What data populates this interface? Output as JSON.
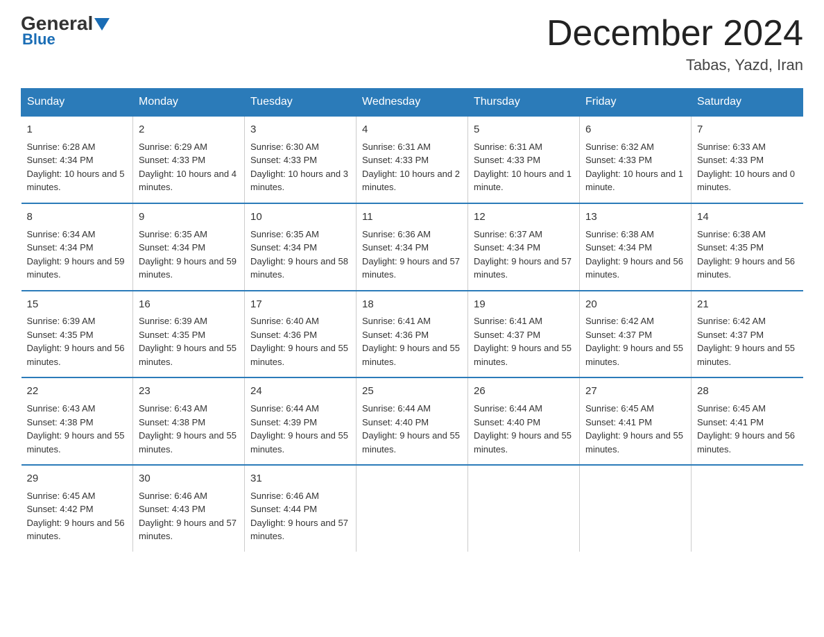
{
  "header": {
    "logo_general": "General",
    "logo_blue": "Blue",
    "month_title": "December 2024",
    "location": "Tabas, Yazd, Iran"
  },
  "days_of_week": [
    "Sunday",
    "Monday",
    "Tuesday",
    "Wednesday",
    "Thursday",
    "Friday",
    "Saturday"
  ],
  "weeks": [
    [
      {
        "day": "1",
        "sunrise": "6:28 AM",
        "sunset": "4:34 PM",
        "daylight": "10 hours and 5 minutes."
      },
      {
        "day": "2",
        "sunrise": "6:29 AM",
        "sunset": "4:33 PM",
        "daylight": "10 hours and 4 minutes."
      },
      {
        "day": "3",
        "sunrise": "6:30 AM",
        "sunset": "4:33 PM",
        "daylight": "10 hours and 3 minutes."
      },
      {
        "day": "4",
        "sunrise": "6:31 AM",
        "sunset": "4:33 PM",
        "daylight": "10 hours and 2 minutes."
      },
      {
        "day": "5",
        "sunrise": "6:31 AM",
        "sunset": "4:33 PM",
        "daylight": "10 hours and 1 minute."
      },
      {
        "day": "6",
        "sunrise": "6:32 AM",
        "sunset": "4:33 PM",
        "daylight": "10 hours and 1 minute."
      },
      {
        "day": "7",
        "sunrise": "6:33 AM",
        "sunset": "4:33 PM",
        "daylight": "10 hours and 0 minutes."
      }
    ],
    [
      {
        "day": "8",
        "sunrise": "6:34 AM",
        "sunset": "4:34 PM",
        "daylight": "9 hours and 59 minutes."
      },
      {
        "day": "9",
        "sunrise": "6:35 AM",
        "sunset": "4:34 PM",
        "daylight": "9 hours and 59 minutes."
      },
      {
        "day": "10",
        "sunrise": "6:35 AM",
        "sunset": "4:34 PM",
        "daylight": "9 hours and 58 minutes."
      },
      {
        "day": "11",
        "sunrise": "6:36 AM",
        "sunset": "4:34 PM",
        "daylight": "9 hours and 57 minutes."
      },
      {
        "day": "12",
        "sunrise": "6:37 AM",
        "sunset": "4:34 PM",
        "daylight": "9 hours and 57 minutes."
      },
      {
        "day": "13",
        "sunrise": "6:38 AM",
        "sunset": "4:34 PM",
        "daylight": "9 hours and 56 minutes."
      },
      {
        "day": "14",
        "sunrise": "6:38 AM",
        "sunset": "4:35 PM",
        "daylight": "9 hours and 56 minutes."
      }
    ],
    [
      {
        "day": "15",
        "sunrise": "6:39 AM",
        "sunset": "4:35 PM",
        "daylight": "9 hours and 56 minutes."
      },
      {
        "day": "16",
        "sunrise": "6:39 AM",
        "sunset": "4:35 PM",
        "daylight": "9 hours and 55 minutes."
      },
      {
        "day": "17",
        "sunrise": "6:40 AM",
        "sunset": "4:36 PM",
        "daylight": "9 hours and 55 minutes."
      },
      {
        "day": "18",
        "sunrise": "6:41 AM",
        "sunset": "4:36 PM",
        "daylight": "9 hours and 55 minutes."
      },
      {
        "day": "19",
        "sunrise": "6:41 AM",
        "sunset": "4:37 PM",
        "daylight": "9 hours and 55 minutes."
      },
      {
        "day": "20",
        "sunrise": "6:42 AM",
        "sunset": "4:37 PM",
        "daylight": "9 hours and 55 minutes."
      },
      {
        "day": "21",
        "sunrise": "6:42 AM",
        "sunset": "4:37 PM",
        "daylight": "9 hours and 55 minutes."
      }
    ],
    [
      {
        "day": "22",
        "sunrise": "6:43 AM",
        "sunset": "4:38 PM",
        "daylight": "9 hours and 55 minutes."
      },
      {
        "day": "23",
        "sunrise": "6:43 AM",
        "sunset": "4:38 PM",
        "daylight": "9 hours and 55 minutes."
      },
      {
        "day": "24",
        "sunrise": "6:44 AM",
        "sunset": "4:39 PM",
        "daylight": "9 hours and 55 minutes."
      },
      {
        "day": "25",
        "sunrise": "6:44 AM",
        "sunset": "4:40 PM",
        "daylight": "9 hours and 55 minutes."
      },
      {
        "day": "26",
        "sunrise": "6:44 AM",
        "sunset": "4:40 PM",
        "daylight": "9 hours and 55 minutes."
      },
      {
        "day": "27",
        "sunrise": "6:45 AM",
        "sunset": "4:41 PM",
        "daylight": "9 hours and 55 minutes."
      },
      {
        "day": "28",
        "sunrise": "6:45 AM",
        "sunset": "4:41 PM",
        "daylight": "9 hours and 56 minutes."
      }
    ],
    [
      {
        "day": "29",
        "sunrise": "6:45 AM",
        "sunset": "4:42 PM",
        "daylight": "9 hours and 56 minutes."
      },
      {
        "day": "30",
        "sunrise": "6:46 AM",
        "sunset": "4:43 PM",
        "daylight": "9 hours and 57 minutes."
      },
      {
        "day": "31",
        "sunrise": "6:46 AM",
        "sunset": "4:44 PM",
        "daylight": "9 hours and 57 minutes."
      },
      {
        "day": "",
        "sunrise": "",
        "sunset": "",
        "daylight": ""
      },
      {
        "day": "",
        "sunrise": "",
        "sunset": "",
        "daylight": ""
      },
      {
        "day": "",
        "sunrise": "",
        "sunset": "",
        "daylight": ""
      },
      {
        "day": "",
        "sunrise": "",
        "sunset": "",
        "daylight": ""
      }
    ]
  ],
  "labels": {
    "sunrise": "Sunrise: ",
    "sunset": "Sunset: ",
    "daylight": "Daylight: "
  }
}
